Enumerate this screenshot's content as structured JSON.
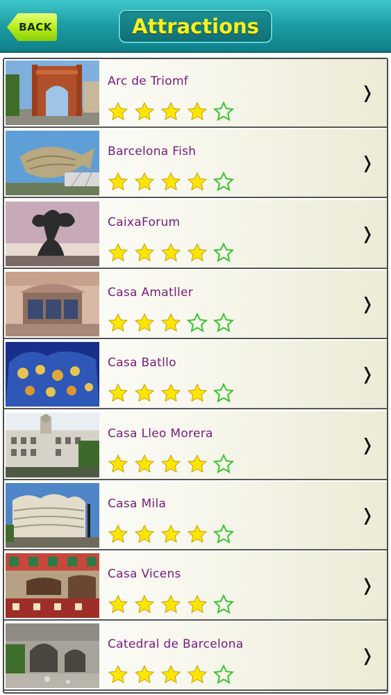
{
  "header": {
    "back_label": "BACK",
    "title": "Attractions"
  },
  "colors": {
    "header": "#1f9fa6",
    "title_text": "#f4f221",
    "back_button": "#b7ef1c",
    "item_text": "#7a1a7a",
    "star_filled": "#ffe600",
    "star_empty_outline": "#35c42e"
  },
  "attractions": [
    {
      "name": "Arc de Triomf",
      "rating": 4,
      "max_rating": 5,
      "thumbnail_icon": "triumphal-arch-photo"
    },
    {
      "name": "Barcelona Fish",
      "rating": 4,
      "max_rating": 5,
      "thumbnail_icon": "fish-sculpture-photo"
    },
    {
      "name": "CaixaForum",
      "rating": 4,
      "max_rating": 5,
      "thumbnail_icon": "statue-photo"
    },
    {
      "name": "Casa Amatller",
      "rating": 3,
      "max_rating": 5,
      "thumbnail_icon": "facade-photo"
    },
    {
      "name": "Casa Batllo",
      "rating": 4,
      "max_rating": 5,
      "thumbnail_icon": "night-facade-photo"
    },
    {
      "name": "Casa Lleo Morera",
      "rating": 4,
      "max_rating": 5,
      "thumbnail_icon": "building-photo"
    },
    {
      "name": "Casa Mila",
      "rating": 4,
      "max_rating": 5,
      "thumbnail_icon": "wavy-building-photo"
    },
    {
      "name": "Casa Vicens",
      "rating": 4,
      "max_rating": 5,
      "thumbnail_icon": "tiled-facade-photo"
    },
    {
      "name": "Catedral de Barcelona",
      "rating": 4,
      "max_rating": 5,
      "thumbnail_icon": "cloister-photo"
    }
  ]
}
